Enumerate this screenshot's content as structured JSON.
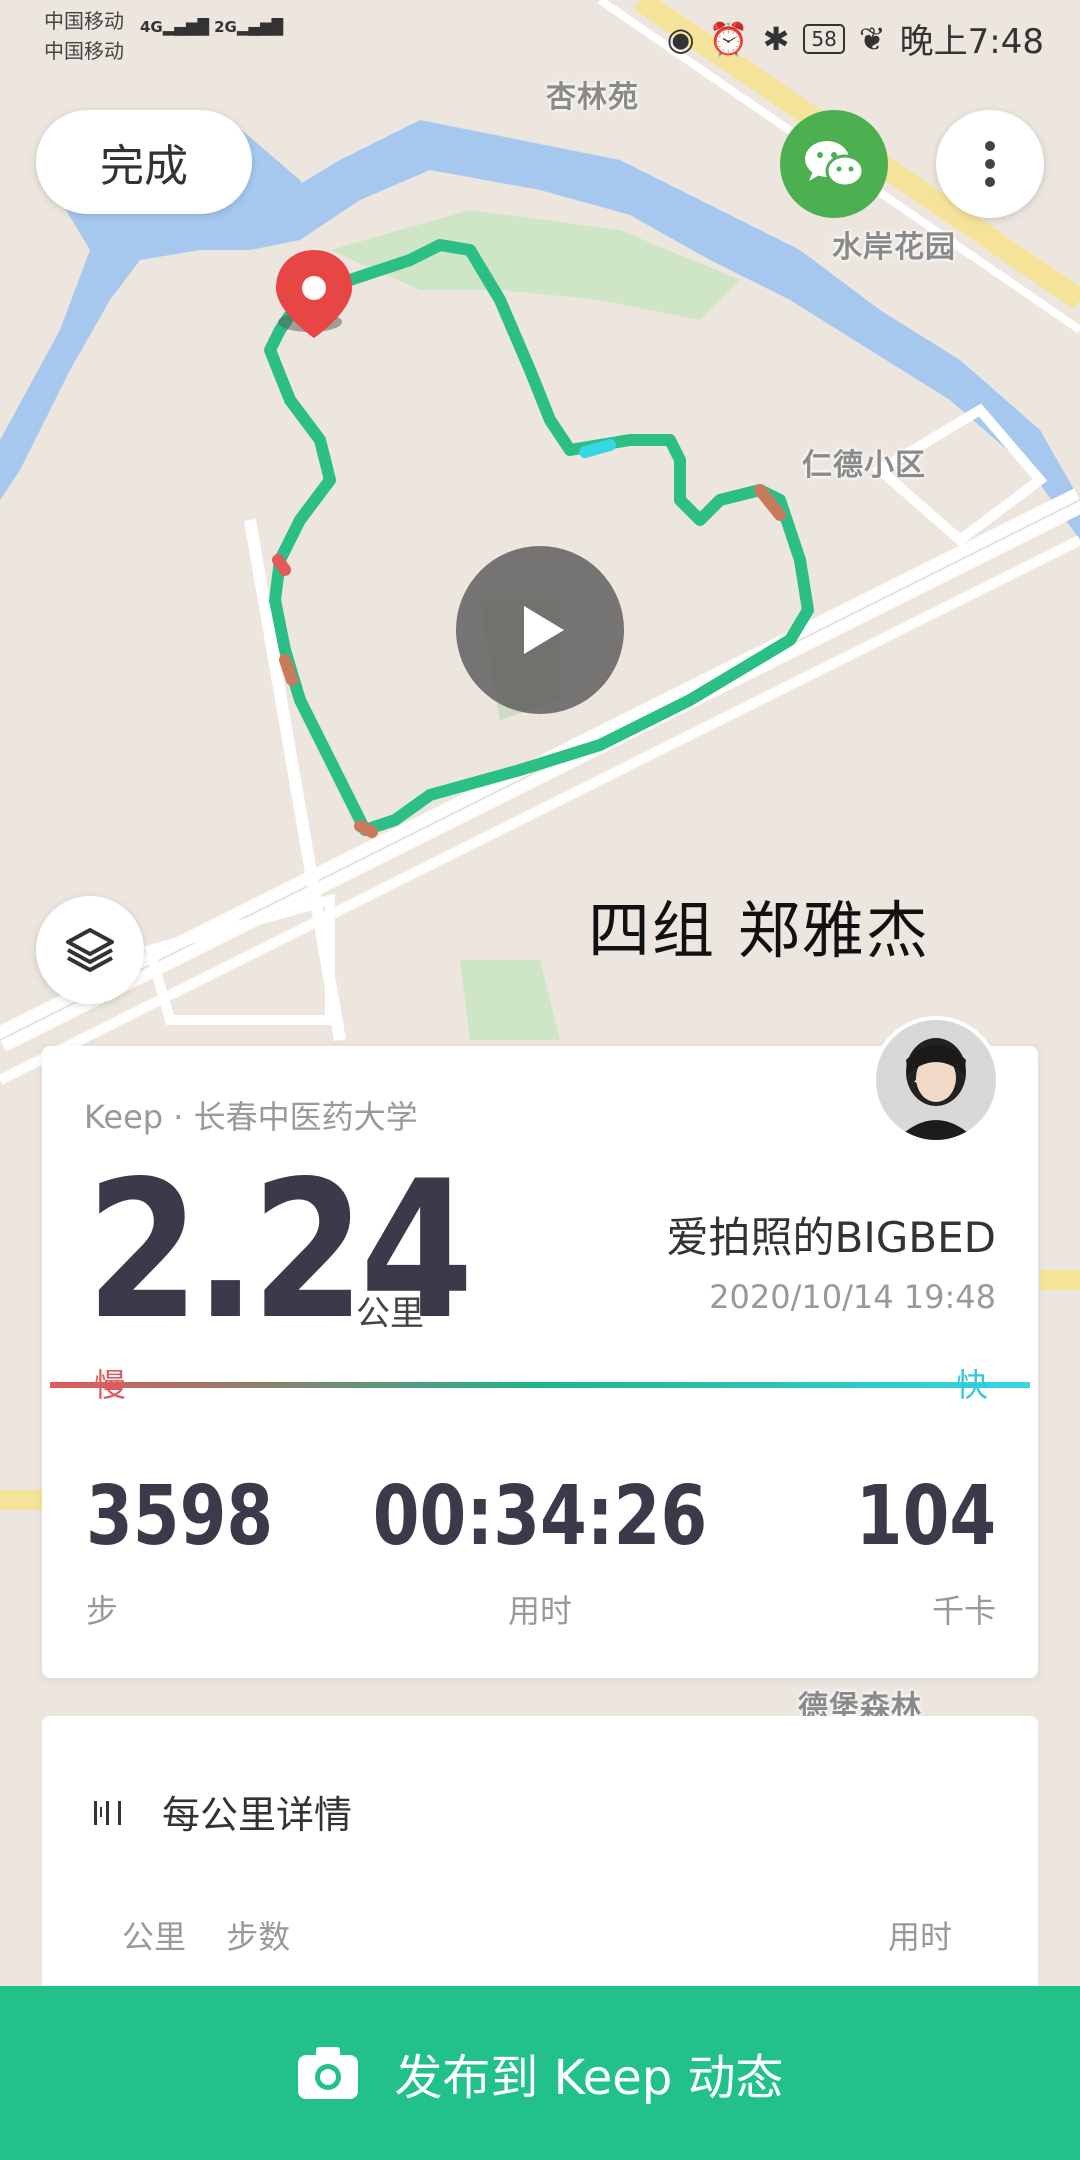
{
  "status_bar": {
    "carrier1": "中国移动",
    "carrier2": "中国移动",
    "signal1": "4G",
    "signal2": "2G",
    "battery": "58",
    "time": "晚上7:48"
  },
  "map": {
    "labels": [
      "杏林苑",
      "水岸花园",
      "仁德小区",
      "德堡森林"
    ],
    "route_color": "#2bbf85"
  },
  "toolbar": {
    "done_label": "完成"
  },
  "overlay_text": "四组 郑雅杰",
  "summary": {
    "source": "Keep · 长春中医药大学",
    "distance": "2.24",
    "distance_unit": "公里",
    "username": "爱拍照的BIGBED",
    "datetime": "2020/10/14 19:48",
    "slow_label": "慢",
    "fast_label": "快",
    "stats": [
      {
        "value": "3598",
        "label": "步"
      },
      {
        "value": "00:34:26",
        "label": "用时"
      },
      {
        "value": "104",
        "label": "千卡"
      }
    ]
  },
  "splits": {
    "title": "每公里详情",
    "columns": [
      "公里",
      "步数"
    ],
    "time_column": "用时"
  },
  "publish": {
    "label": "发布到 Keep 动态"
  }
}
